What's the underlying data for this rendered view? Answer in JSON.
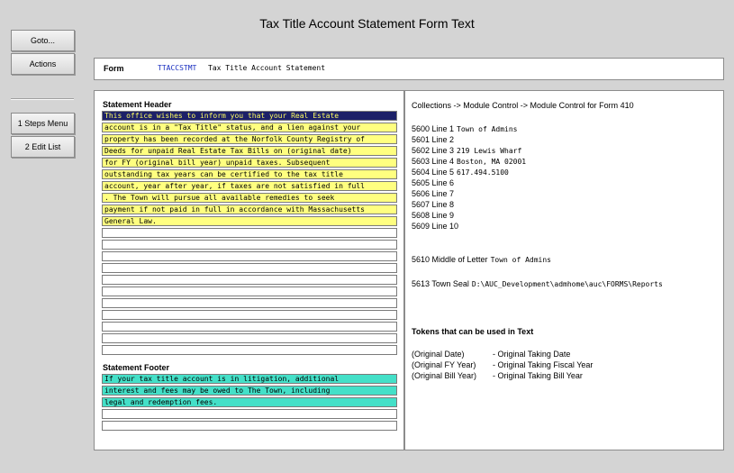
{
  "window": {
    "title": "Tax Title Account Statement Form Text"
  },
  "side_buttons": {
    "goto": "Goto...",
    "actions": "Actions",
    "steps_menu": "1 Steps Menu",
    "edit_list": "2 Edit List"
  },
  "form": {
    "label": "Form",
    "code": "TTACCSTMT",
    "name": "Tax Title Account Statement"
  },
  "statement_header": {
    "label": "Statement Header",
    "lines": [
      "This office wishes to inform you that your Real Estate",
      "account is in a \"Tax Title\" status, and a lien against your",
      "property has been recorded at the Norfolk County Registry of",
      "Deeds for unpaid Real Estate Tax Bills on (original date)",
      "for FY (original bill year) unpaid taxes. Subsequent",
      "outstanding tax years can be certified to the tax title",
      "account, year after year, if taxes are not satisfied in full",
      ". The Town will pursue all available remedies to seek",
      "payment if not paid in full in accordance with Massachusetts",
      "General Law.",
      "",
      "",
      "",
      "",
      "",
      "",
      "",
      "",
      "",
      "",
      ""
    ]
  },
  "statement_footer": {
    "label": "Statement Footer",
    "lines": [
      "If your tax title account is in litigation, additional",
      "interest and fees may be owed to The Town, including",
      "legal and redemption fees.",
      "",
      ""
    ]
  },
  "module_control": {
    "heading": "Collections -> Module Control -> Module Control for Form 410",
    "lines": [
      {
        "key": "5600 Line 1",
        "value": "Town of Admins"
      },
      {
        "key": "5601 Line 2",
        "value": ""
      },
      {
        "key": "5602 Line 3",
        "value": "219 Lewis Wharf"
      },
      {
        "key": "5603 Line 4",
        "value": "Boston, MA 02001"
      },
      {
        "key": "5604 Line 5",
        "value": "617.494.5100"
      },
      {
        "key": "5605 Line 6",
        "value": ""
      },
      {
        "key": "5606 Line 7",
        "value": ""
      },
      {
        "key": "5607 Line 8",
        "value": ""
      },
      {
        "key": "5608 Line 9",
        "value": ""
      },
      {
        "key": "5609 Line 10",
        "value": ""
      }
    ],
    "middle_of_letter": {
      "key": "5610 Middle of Letter",
      "value": "Town of Admins"
    },
    "town_seal": {
      "key": "5613 Town Seal",
      "value": "D:\\AUC_Development\\admhome\\auc\\FORMS\\Reports"
    }
  },
  "tokens": {
    "title": "Tokens that can be used in Text",
    "items": [
      {
        "token": "(Original Date)",
        "desc": "- Original Taking Date"
      },
      {
        "token": "(Original FY Year)",
        "desc": "- Original Taking Fiscal Year"
      },
      {
        "token": "(Original Bill Year)",
        "desc": "- Original Taking Bill Year"
      }
    ]
  }
}
